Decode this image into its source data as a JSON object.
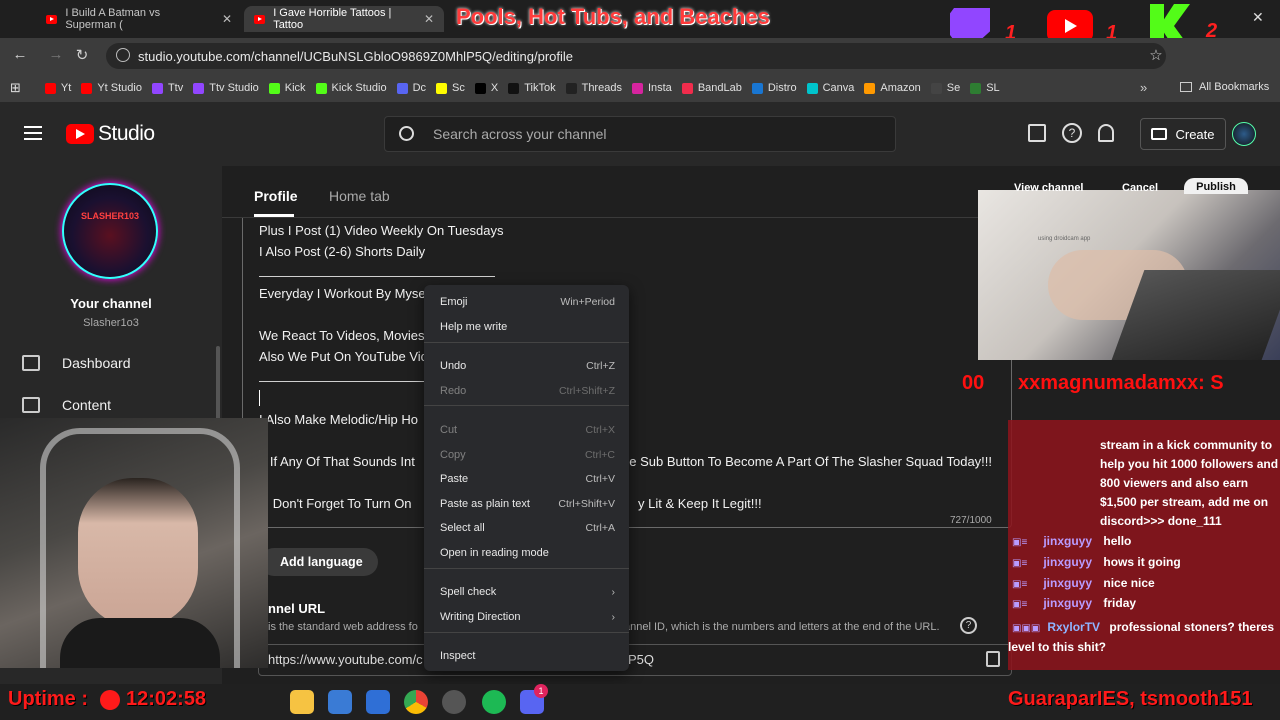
{
  "browser": {
    "tabs": [
      {
        "title": "I Build A Batman vs Superman (",
        "active": false
      },
      {
        "title": "I Gave Horrible Tattoos | Tattoo",
        "active": true
      }
    ],
    "url": "studio.youtube.com/channel/UCBuNSLGbloO9869Z0MhlP5Q/editing/profile",
    "bookmarks": [
      {
        "label": "Yt",
        "color": "#ff0000"
      },
      {
        "label": "Yt Studio",
        "color": "#ff0000"
      },
      {
        "label": "Ttv",
        "color": "#9146ff"
      },
      {
        "label": "Ttv Studio",
        "color": "#9146ff"
      },
      {
        "label": "Kick",
        "color": "#53fc18"
      },
      {
        "label": "Kick Studio",
        "color": "#53fc18"
      },
      {
        "label": "Dc",
        "color": "#5865f2"
      },
      {
        "label": "Sc",
        "color": "#fffc00"
      },
      {
        "label": "X",
        "color": "#000000"
      },
      {
        "label": "TikTok",
        "color": "#111111"
      },
      {
        "label": "Threads",
        "color": "#222222"
      },
      {
        "label": "Insta",
        "color": "#d6249f"
      },
      {
        "label": "BandLab",
        "color": "#f12c4c"
      },
      {
        "label": "Distro",
        "color": "#1976d2"
      },
      {
        "label": "Canva",
        "color": "#00c4cc"
      },
      {
        "label": "Amazon",
        "color": "#ff9900"
      },
      {
        "label": "Se",
        "color": "#444444"
      },
      {
        "label": "SL",
        "color": "#2e7d32"
      }
    ],
    "all_bookmarks": "All Bookmarks"
  },
  "overlay": {
    "top_title": "Pools, Hot Tubs, and Beaches",
    "uptime_label": "Uptime :",
    "uptime_value": "12:02:58",
    "ticker_right": "GuaraparIES, tsmooth151",
    "ticker_chat": "xxmagnumadamxx: S",
    "ticker_count": "00",
    "cam_watermark": "using droidcam app",
    "badge_a": "1",
    "badge_b": "1",
    "badge_c": "2"
  },
  "studio": {
    "logo": "Studio",
    "search_placeholder": "Search across your channel",
    "create": "Create",
    "channel_label": "Your channel",
    "channel_handle": "Slasher1o3",
    "avatar_text": "SLASHER103",
    "nav": [
      {
        "label": "Dashboard"
      },
      {
        "label": "Content"
      }
    ],
    "tabs": [
      {
        "label": "Profile",
        "active": true
      },
      {
        "label": "Home tab",
        "active": false
      }
    ],
    "actions": {
      "view_channel": "View channel",
      "cancel": "Cancel",
      "publish": "Publish"
    },
    "description_lines": [
      "Plus I Post (1) Video Weekly On Tuesdays",
      "I Also Post (2-6) Shorts Daily",
      "Everyday I Workout By Myse",
      "We React To Videos, Movies",
      "Also We Put On YouTube Vic",
      "I Also Make Melodic/Hip Ho",
      "o If Any Of That Sounds Int",
      "s. Don't Forget To Turn On"
    ],
    "description_right": [
      "he Sub Button To Become A Part Of The Slasher Squad Today!!!",
      "y Lit & Keep It Legit!!!"
    ],
    "char_count": "727/1000",
    "add_language": "Add language",
    "channel_url_title": "nnel URL",
    "channel_url_help_left": "is the standard web address fo",
    "channel_url_help_right": "annel ID, which is the numbers and letters at the end of the URL.",
    "channel_url_left": "https://www.youtube.com/c",
    "channel_url_right": "P5Q"
  },
  "context_menu": {
    "items": [
      {
        "label": "Emoji",
        "shortcut": "Win+Period",
        "disabled": false
      },
      {
        "label": "Help me write",
        "shortcut": "",
        "disabled": false
      },
      {
        "label": "Undo",
        "shortcut": "Ctrl+Z",
        "disabled": false
      },
      {
        "label": "Redo",
        "shortcut": "Ctrl+Shift+Z",
        "disabled": true
      },
      {
        "label": "Cut",
        "shortcut": "Ctrl+X",
        "disabled": true
      },
      {
        "label": "Copy",
        "shortcut": "Ctrl+C",
        "disabled": true
      },
      {
        "label": "Paste",
        "shortcut": "Ctrl+V",
        "disabled": false
      },
      {
        "label": "Paste as plain text",
        "shortcut": "Ctrl+Shift+V",
        "disabled": false
      },
      {
        "label": "Select all",
        "shortcut": "Ctrl+A",
        "disabled": false
      },
      {
        "label": "Open in reading mode",
        "shortcut": "",
        "disabled": false
      },
      {
        "label": "Spell check",
        "shortcut": "›",
        "disabled": false
      },
      {
        "label": "Writing Direction",
        "shortcut": "›",
        "disabled": false
      },
      {
        "label": "Inspect",
        "shortcut": "",
        "disabled": false
      }
    ]
  },
  "chat": {
    "intro": "stream in a kick community to help you hit 1000 followers and 800 viewers and also earn $1,500 per stream, add me on discord>>> done_111",
    "messages": [
      {
        "user": "jinxguyy",
        "text": "hello"
      },
      {
        "user": "jinxguyy",
        "text": "hows it going"
      },
      {
        "user": "jinxguyy",
        "text": "nice nice"
      },
      {
        "user": "jinxguyy",
        "text": "friday"
      },
      {
        "user": "RxylorTV",
        "text": "professional stoners? theres level to this shit?"
      }
    ]
  },
  "taskbar": {
    "notification_count": "1"
  }
}
